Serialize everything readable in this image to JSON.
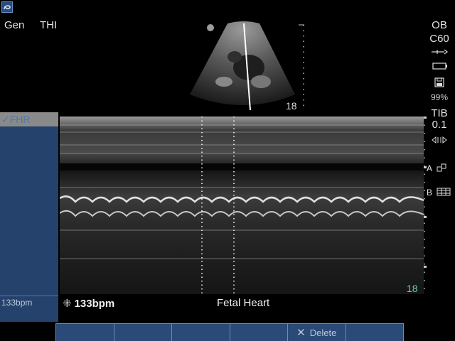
{
  "header": {
    "preset": "Gen",
    "imaging_mode": "THI"
  },
  "bmode": {
    "depth": "18"
  },
  "right_panel": {
    "exam": "OB",
    "transducer": "C60",
    "battery_percent": "99%",
    "index_label": "TIB",
    "index_value": "0.1",
    "marker_a": "A",
    "marker_b": "B"
  },
  "left_panel": {
    "header": "FHR",
    "bpm_value": "133bpm"
  },
  "mmode": {
    "depth": "18"
  },
  "caption": {
    "bpm": "133bpm",
    "title": "Fetal Heart"
  },
  "softkeys": [
    "",
    "",
    "",
    "",
    "Delete",
    ""
  ],
  "colors": {
    "panel": "#24426c",
    "softkey": "#2a4a78",
    "teal_depth": "#6fc7c0"
  }
}
